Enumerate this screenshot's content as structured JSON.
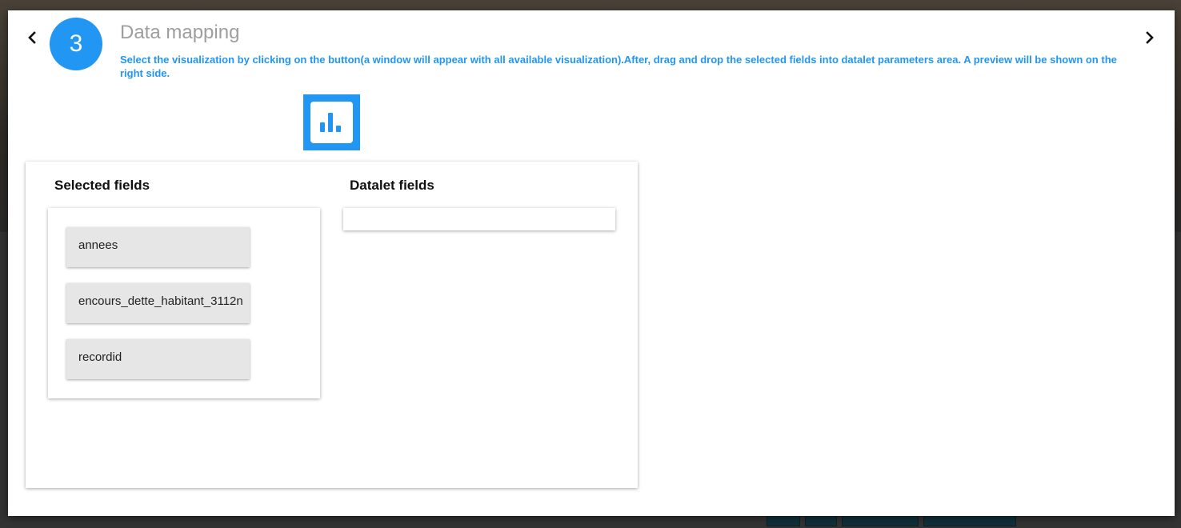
{
  "step": {
    "number": "3",
    "title": "Data mapping",
    "description": "Select the visualization by clicking on the button(a window will appear with all available visualization).After, drag and drop the selected fields into datalet parameters area. A preview will be shown on the right side."
  },
  "navigation": {
    "prev_icon": "chevron-left-icon",
    "next_icon": "chevron-right-icon"
  },
  "visualization_button": {
    "icon": "bar-chart-icon",
    "color": "#2196F3"
  },
  "selected_fields": {
    "title": "Selected fields",
    "items": [
      "annees",
      "encours_dette_habitant_3112n",
      "recordid"
    ]
  },
  "datalet_fields": {
    "title": "Datalet fields",
    "items": []
  },
  "colors": {
    "accent": "#2196F3",
    "chip": "#e6e6e6"
  }
}
